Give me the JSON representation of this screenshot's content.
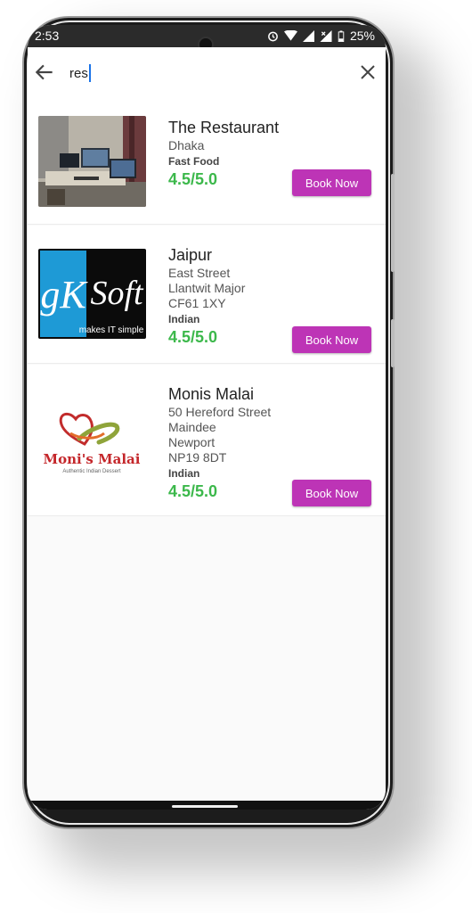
{
  "status": {
    "time": "2:53",
    "battery": "25%"
  },
  "search": {
    "query": "res"
  },
  "icons": {
    "back": "arrow-left-icon",
    "close": "close-icon"
  },
  "colors": {
    "accent": "#bd34b6",
    "rating": "#3cb84b"
  },
  "restaurants": [
    {
      "name": "The Restaurant",
      "address": [
        "Dhaka"
      ],
      "category": "Fast Food",
      "rating": "4.5/5.0",
      "button": "Book Now"
    },
    {
      "name": "Jaipur",
      "address": [
        "East Street",
        "Llantwit Major",
        "CF61 1XY"
      ],
      "category": "Indian",
      "rating": "4.5/5.0",
      "button": "Book Now",
      "logo": {
        "brand": "Soft",
        "initials": "gK",
        "tagline": "makes IT simple"
      }
    },
    {
      "name": "Monis Malai",
      "address": [
        "50 Hereford Street",
        "Maindee",
        "Newport",
        "NP19 8DT"
      ],
      "category": "Indian",
      "rating": "4.5/5.0",
      "button": "Book Now",
      "logo": {
        "brand": "Moni's Malai",
        "tagline": "Authentic Indian Dessert"
      }
    }
  ]
}
